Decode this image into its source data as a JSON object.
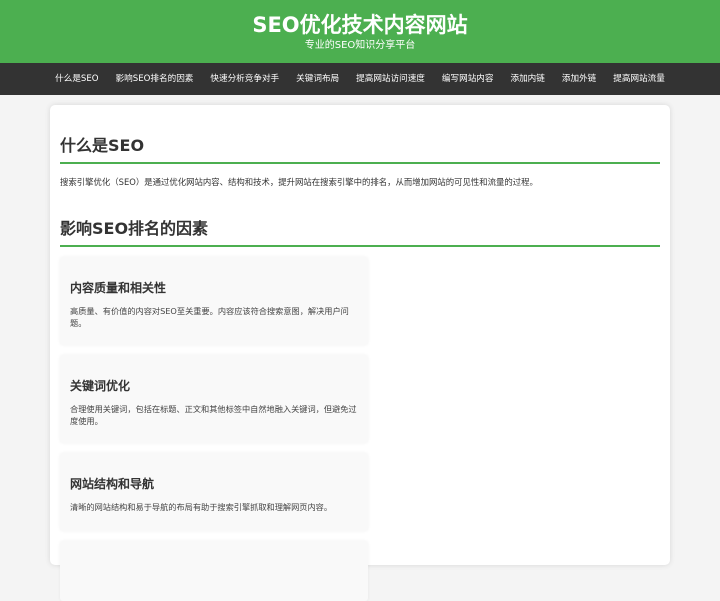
{
  "header": {
    "title": "SEO优化技术内容网站",
    "subtitle": "专业的SEO知识分享平台"
  },
  "nav": {
    "items": [
      "什么是SEO",
      "影响SEO排名的因素",
      "快速分析竞争对手",
      "关键词布局",
      "提高网站访问速度",
      "编写网站内容",
      "添加内链",
      "添加外链",
      "提高网站流量"
    ]
  },
  "main": {
    "section1": {
      "title": "什么是SEO",
      "text": "搜索引擎优化（SEO）是通过优化网站内容、结构和技术，提升网站在搜索引擎中的排名，从而增加网站的可见性和流量的过程。"
    },
    "section2": {
      "title": "影响SEO排名的因素",
      "cards": [
        {
          "title": "内容质量和相关性",
          "text": "高质量、有价值的内容对SEO至关重要。内容应该符合搜索意图，解决用户问题。"
        },
        {
          "title": "关键词优化",
          "text": "合理使用关键词，包括在标题、正文和其他标签中自然地融入关键词，但避免过度使用。"
        },
        {
          "title": "网站结构和导航",
          "text": "清晰的网站结构和易于导航的布局有助于搜索引擎抓取和理解网页内容。"
        }
      ]
    }
  }
}
